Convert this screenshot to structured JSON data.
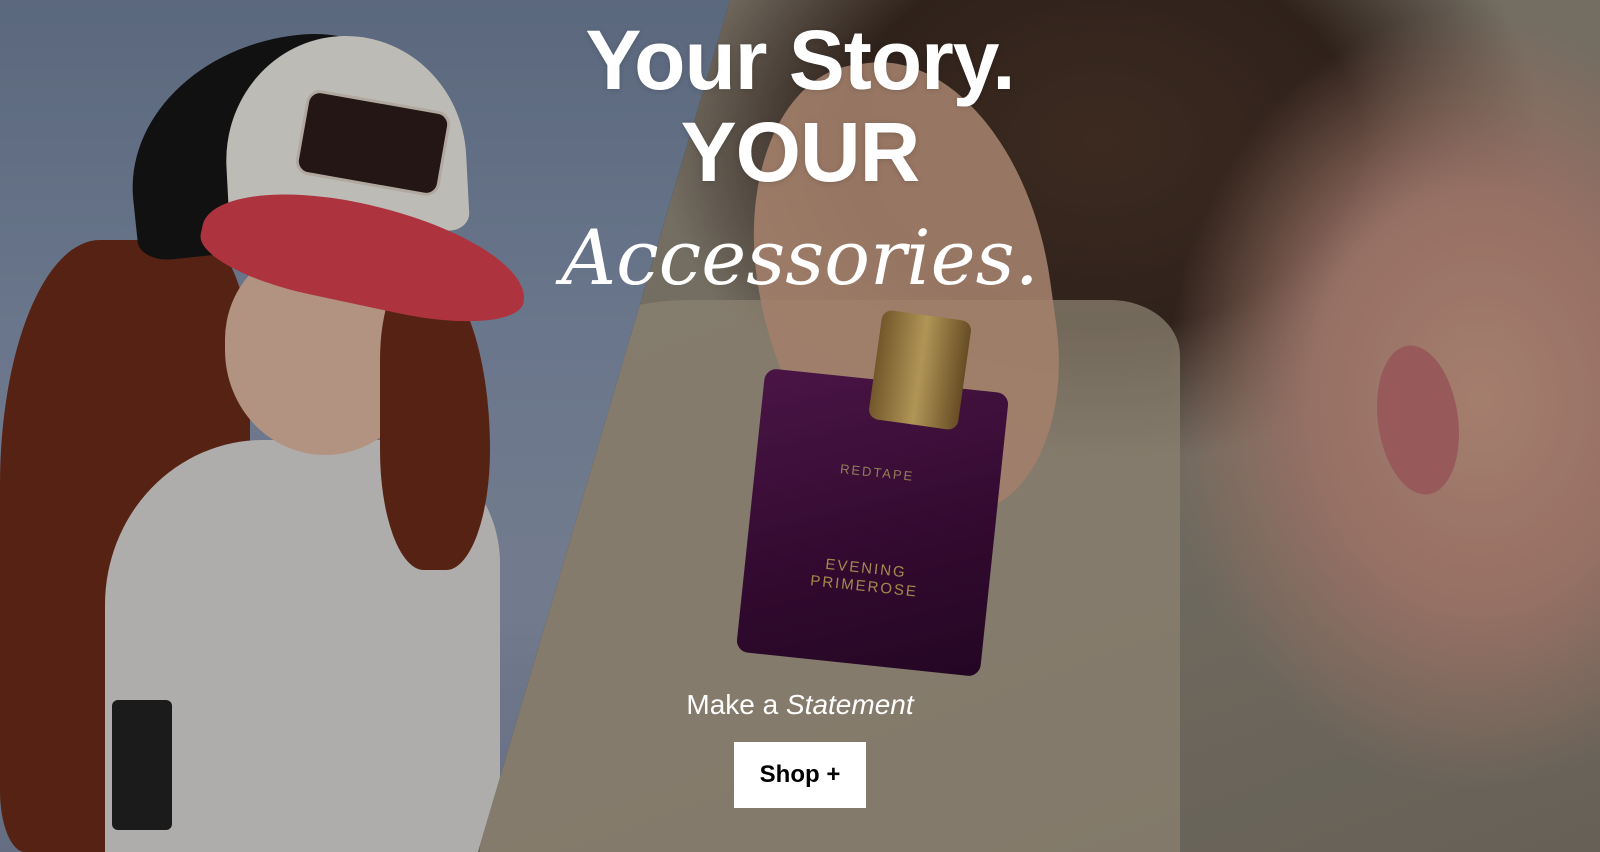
{
  "hero": {
    "headline_line1": "Your Story.",
    "headline_line2": "YOUR",
    "headline_script": "Accessories.",
    "tagline_prefix": "Make a",
    "tagline_emphasis": "Statement",
    "cta_label": "Shop +"
  },
  "product": {
    "brand_mark": "REDTAPE",
    "name": "EVENING PRIMEROSE"
  },
  "colors": {
    "text": "#ffffff",
    "button_bg": "#ffffff",
    "button_text": "#000000"
  }
}
